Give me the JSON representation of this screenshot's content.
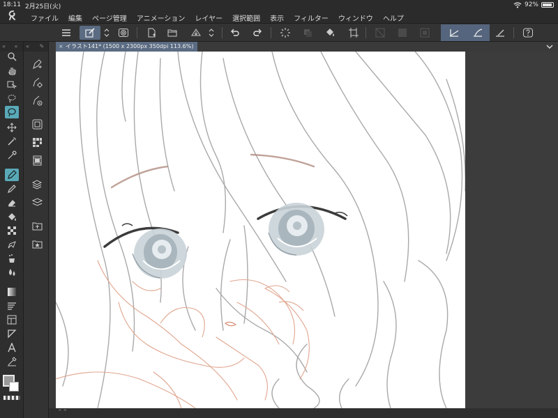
{
  "status": {
    "time": "18:11",
    "date": "2月25日(火)",
    "battery": "92%"
  },
  "menu": [
    "ファイル",
    "編集",
    "ページ管理",
    "アニメーション",
    "レイヤー",
    "選択範囲",
    "表示",
    "フィルター",
    "ウィンドウ",
    "ヘルプ"
  ],
  "document": {
    "tab_title": "イラスト141* (1500 x 2300px 350dpi 113.6%)"
  },
  "palette": {
    "collapse_glyph": "«",
    "expand_glyph": "»",
    "bottom_chevron": "⌃⌃"
  },
  "colors": {
    "main_color": "#9a9a9a",
    "sub_color": "#ffffff",
    "active_tool": "#5aa9b8",
    "active_toolbar": "#5a6b82"
  }
}
